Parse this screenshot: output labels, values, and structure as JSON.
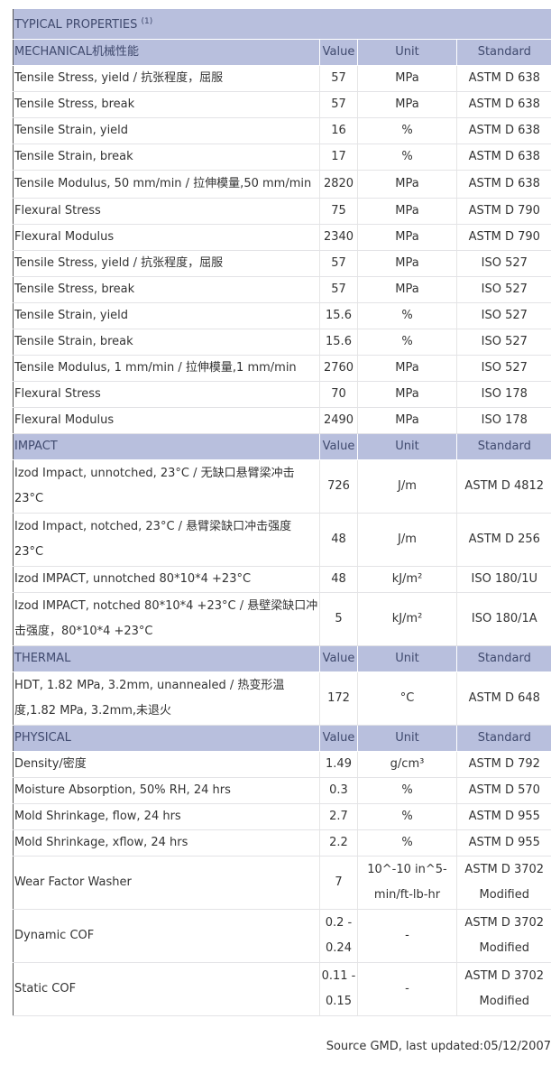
{
  "title": "TYPICAL PROPERTIES",
  "title_note": "(1)",
  "columns": {
    "value": "Value",
    "unit": "Unit",
    "standard": "Standard"
  },
  "sections": [
    {
      "name": "MECHANICAL机械性能",
      "rows": [
        {
          "property": "Tensile Stress, yield / 抗张程度，屈服",
          "value": "57",
          "unit": "MPa",
          "standard": "ASTM D 638"
        },
        {
          "property": "Tensile Stress, break",
          "value": "57",
          "unit": "MPa",
          "standard": "ASTM D 638"
        },
        {
          "property": "Tensile Strain, yield",
          "value": "16",
          "unit": "%",
          "standard": "ASTM D 638"
        },
        {
          "property": "Tensile Strain, break",
          "value": "17",
          "unit": "%",
          "standard": "ASTM D 638"
        },
        {
          "property": "Tensile Modulus, 50 mm/min / 拉伸模量,50 mm/min",
          "value": "2820",
          "unit": "MPa",
          "standard": "ASTM D 638"
        },
        {
          "property": "Flexural Stress",
          "value": "75",
          "unit": "MPa",
          "standard": "ASTM D 790"
        },
        {
          "property": "Flexural Modulus",
          "value": "2340",
          "unit": "MPa",
          "standard": "ASTM D 790"
        },
        {
          "property": "Tensile Stress, yield / 抗张程度，屈服",
          "value": "57",
          "unit": "MPa",
          "standard": "ISO 527"
        },
        {
          "property": "Tensile Stress, break",
          "value": "57",
          "unit": "MPa",
          "standard": "ISO 527"
        },
        {
          "property": "Tensile Strain, yield",
          "value": "15.6",
          "unit": "%",
          "standard": "ISO 527"
        },
        {
          "property": "Tensile Strain, break",
          "value": "15.6",
          "unit": "%",
          "standard": "ISO 527"
        },
        {
          "property": "Tensile Modulus, 1 mm/min / 拉伸模量,1 mm/min",
          "value": "2760",
          "unit": "MPa",
          "standard": "ISO 527"
        },
        {
          "property": "Flexural Stress",
          "value": "70",
          "unit": "MPa",
          "standard": "ISO 178"
        },
        {
          "property": "Flexural Modulus",
          "value": "2490",
          "unit": "MPa",
          "standard": "ISO 178"
        }
      ]
    },
    {
      "name": "IMPACT",
      "rows": [
        {
          "property": "Izod Impact, unnotched, 23°C / 无缺口悬臂梁冲击 23°C",
          "value": "726",
          "unit": "J/m",
          "standard": "ASTM D 4812"
        },
        {
          "property": "Izod Impact, notched, 23°C / 悬臂梁缺口冲击强度 23°C",
          "value": "48",
          "unit": "J/m",
          "standard": "ASTM D 256"
        },
        {
          "property": "Izod IMPACT, unnotched 80*10*4 +23°C",
          "value": "48",
          "unit": "kJ/m²",
          "standard": "ISO 180/1U"
        },
        {
          "property": "Izod IMPACT, notched 80*10*4 +23°C / 悬壁梁缺口冲击强度，80*10*4 +23°C",
          "value": "5",
          "unit": "kJ/m²",
          "standard": "ISO 180/1A"
        }
      ]
    },
    {
      "name": "THERMAL",
      "rows": [
        {
          "property": "HDT, 1.82 MPa, 3.2mm, unannealed / 热变形温度,1.82 MPa, 3.2mm,未退火",
          "value": "172",
          "unit": "°C",
          "standard": "ASTM D 648"
        }
      ]
    },
    {
      "name": "PHYSICAL",
      "rows": [
        {
          "property": "Density/密度",
          "value": "1.49",
          "unit": "g/cm³",
          "standard": "ASTM D 792"
        },
        {
          "property": "Moisture Absorption, 50% RH, 24 hrs",
          "value": "0.3",
          "unit": "%",
          "standard": "ASTM D 570"
        },
        {
          "property": "Mold Shrinkage, flow, 24 hrs",
          "value": "2.7",
          "unit": "%",
          "standard": "ASTM D 955"
        },
        {
          "property": "Mold Shrinkage, xflow, 24 hrs",
          "value": "2.2",
          "unit": "%",
          "standard": "ASTM D 955"
        },
        {
          "property": "Wear Factor Washer",
          "value": "7",
          "unit": "10^-10 in^5-min/ft-lb-hr",
          "standard": "ASTM D 3702 Modified"
        },
        {
          "property": "Dynamic COF",
          "value": "0.2 - 0.24",
          "unit": "-",
          "standard": "ASTM D 3702 Modified"
        },
        {
          "property": "Static COF",
          "value": "0.11 - 0.15",
          "unit": "-",
          "standard": "ASTM D 3702 Modified"
        }
      ]
    }
  ],
  "source": "Source GMD, last updated:05/12/2007",
  "colors": {
    "header_bg": "#b8bfdd",
    "header_text": "#404a6e",
    "text": "#333333",
    "row_border": "#e3e3e6"
  }
}
